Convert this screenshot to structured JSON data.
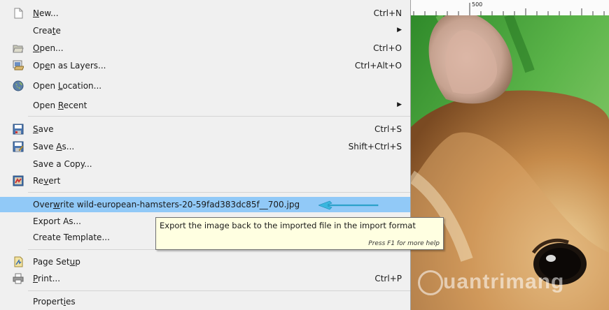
{
  "menu": {
    "items": [
      {
        "label_pre": "",
        "label_ul": "N",
        "label_post": "ew...",
        "accel": "Ctrl+N",
        "icon": "new-file-icon"
      },
      {
        "label_pre": "Crea",
        "label_ul": "t",
        "label_post": "e",
        "accel": "",
        "submenu": true
      },
      {
        "label_pre": "",
        "label_ul": "O",
        "label_post": "pen...",
        "accel": "Ctrl+O",
        "icon": "folder-open-icon"
      },
      {
        "label_pre": "Op",
        "label_ul": "e",
        "label_post": "n as Layers...",
        "accel": "Ctrl+Alt+O",
        "icon": "open-layers-icon"
      },
      {
        "label_pre": "Open ",
        "label_ul": "L",
        "label_post": "ocation...",
        "accel": "",
        "icon": "globe-icon"
      },
      {
        "label_pre": "Open ",
        "label_ul": "R",
        "label_post": "ecent",
        "accel": "",
        "submenu": true
      },
      {
        "label_pre": "",
        "label_ul": "S",
        "label_post": "ave",
        "accel": "Ctrl+S",
        "icon": "save-icon"
      },
      {
        "label_pre": "Save ",
        "label_ul": "A",
        "label_post": "s...",
        "accel": "Shift+Ctrl+S",
        "icon": "save-as-icon"
      },
      {
        "label_pre": "Save a Copy...",
        "label_ul": "",
        "label_post": "",
        "accel": ""
      },
      {
        "label_pre": "Re",
        "label_ul": "v",
        "label_post": "ert",
        "accel": "",
        "icon": "revert-icon"
      },
      {
        "label_pre": "Over",
        "label_ul": "w",
        "label_post": "rite wild-european-hamsters-20-59fad383dc85f__700.jpg",
        "accel": "",
        "selected": true
      },
      {
        "label_pre": "Export As...",
        "label_ul": "",
        "label_post": "",
        "accel": ""
      },
      {
        "label_pre": "Create Template...",
        "label_ul": "",
        "label_post": "",
        "accel": ""
      },
      {
        "label_pre": "Page Set",
        "label_ul": "u",
        "label_post": "p",
        "accel": "",
        "icon": "page-setup-icon"
      },
      {
        "label_pre": "",
        "label_ul": "P",
        "label_post": "rint...",
        "accel": "Ctrl+P",
        "icon": "print-icon"
      },
      {
        "label_pre": "Propert",
        "label_ul": "i",
        "label_post": "es",
        "accel": ""
      }
    ]
  },
  "tooltip": {
    "text": "Export the image back to the imported file in the import format",
    "hint": "Press F1 for more help"
  },
  "ruler": {
    "label": "500"
  },
  "watermark": {
    "text": "uantrimang"
  },
  "colors": {
    "selection": "#91c9f7",
    "arrow": "#39b6de",
    "tooltip_bg": "#ffffe1"
  }
}
